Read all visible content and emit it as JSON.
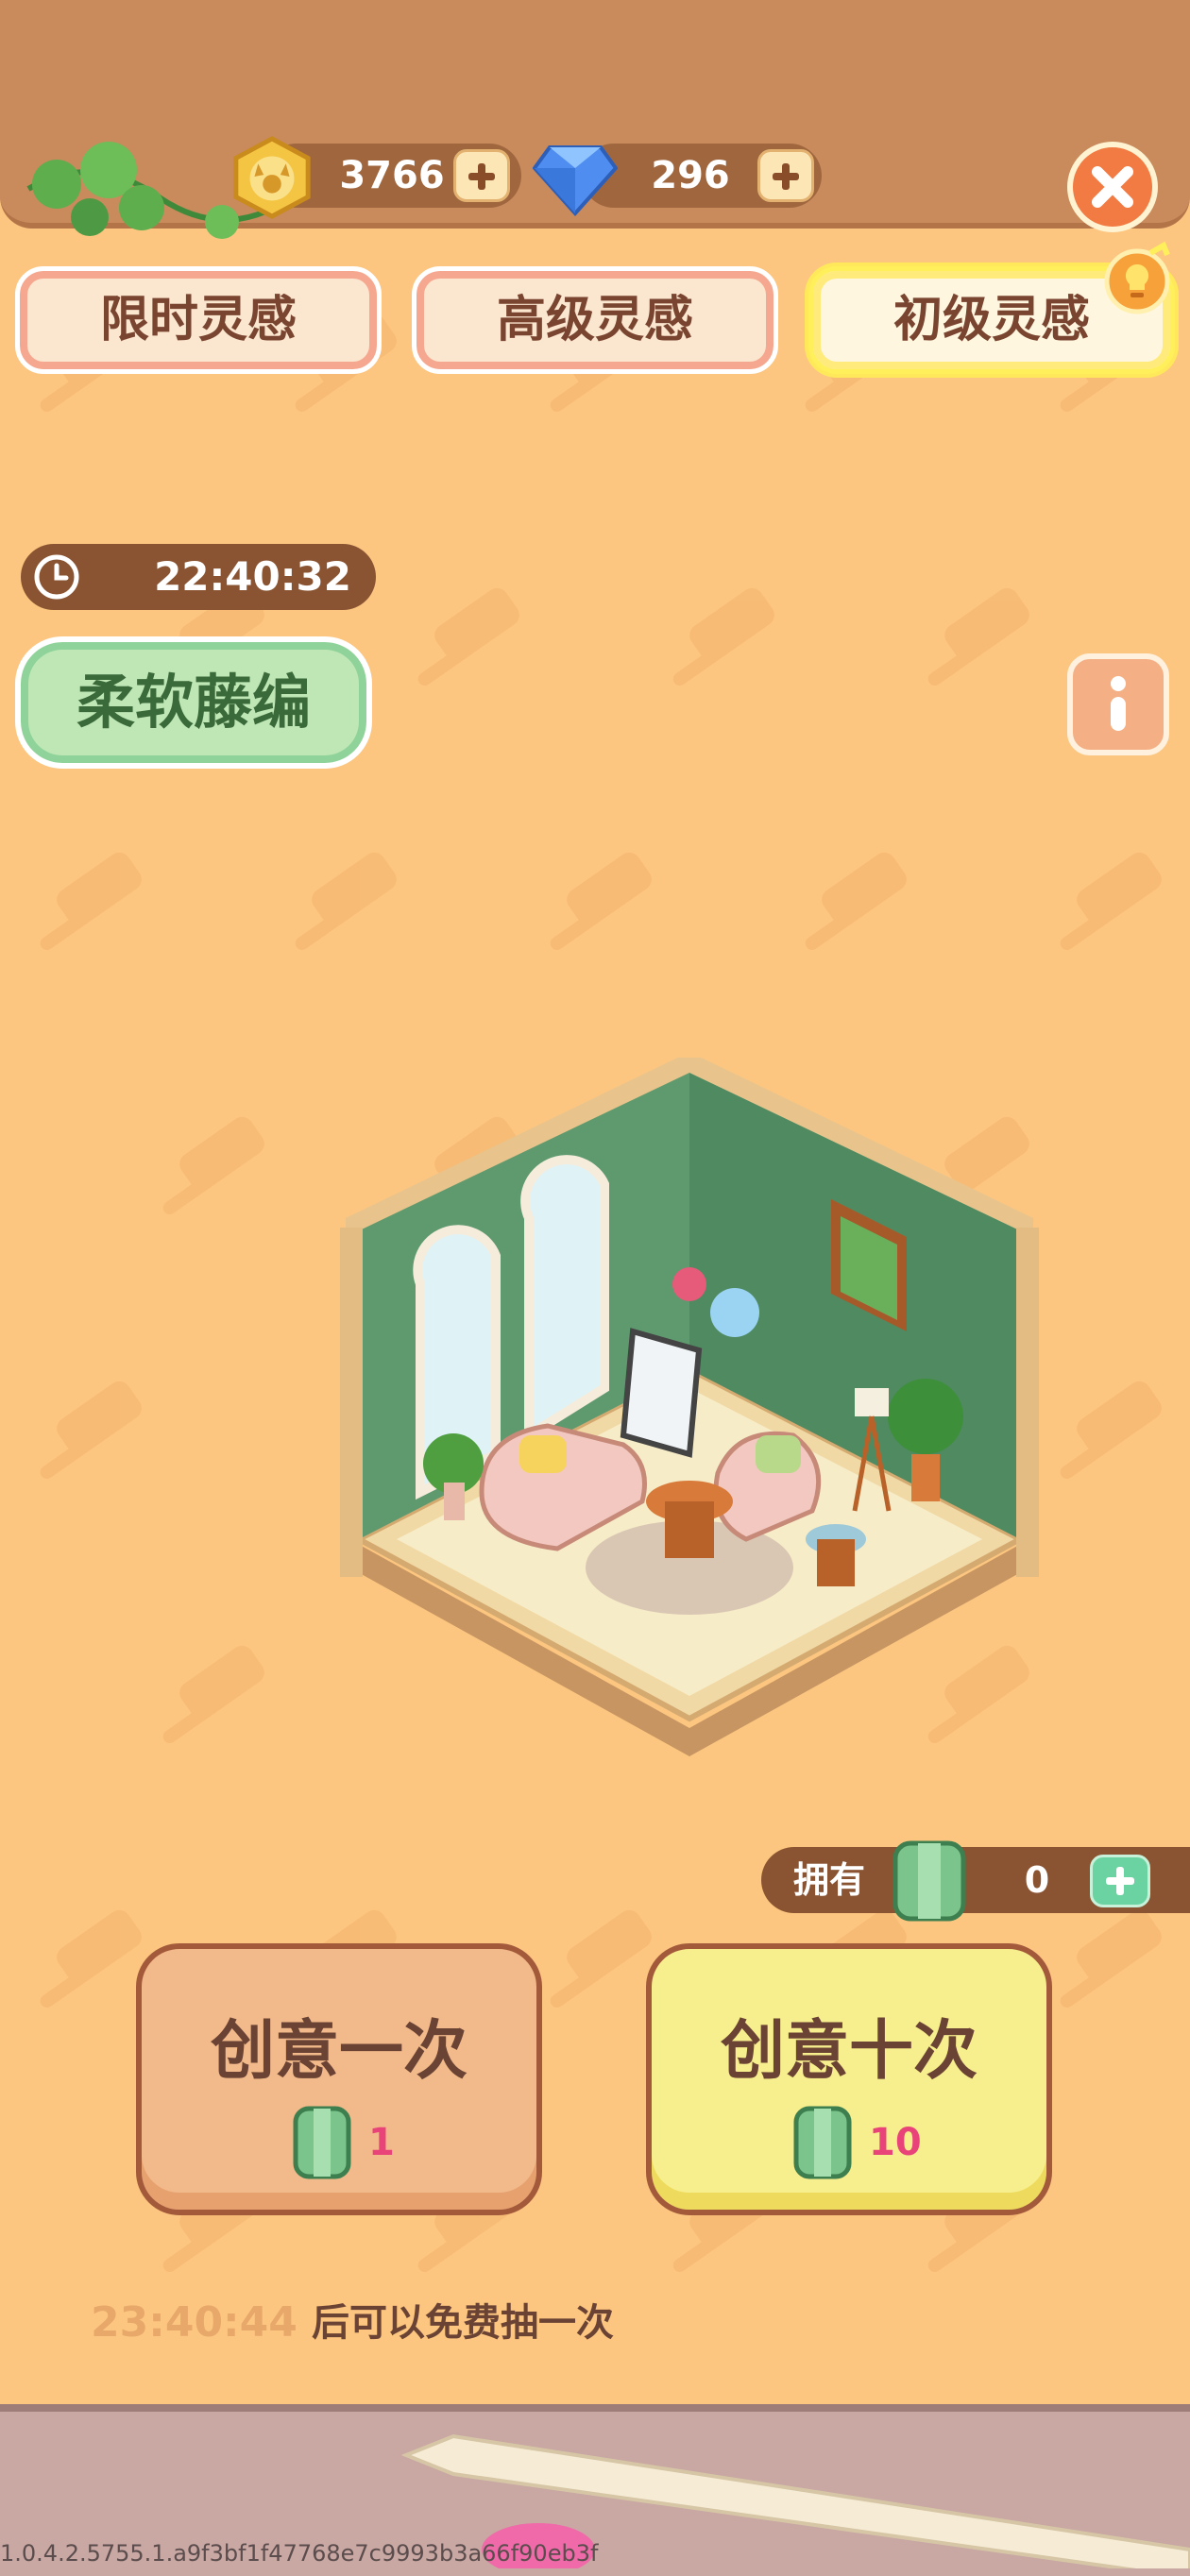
{
  "header": {
    "coins": "3766",
    "gems": "296"
  },
  "tabs": [
    {
      "label": "限时灵感",
      "active": false
    },
    {
      "label": "高级灵感",
      "active": false
    },
    {
      "label": "初级灵感",
      "active": true
    }
  ],
  "timer": {
    "value": "22:40:32"
  },
  "theme": {
    "label": "柔软藤编"
  },
  "owned": {
    "label": "拥有",
    "value": "0"
  },
  "actions": {
    "once": {
      "title": "创意一次",
      "cost": "1"
    },
    "ten": {
      "title": "创意十次",
      "cost": "10"
    }
  },
  "free_draw": {
    "time": "23:40:44",
    "text": "后可以免费抽一次"
  },
  "version": "1.0.4.2.5755.1.a9f3bf1f47768e7c9993b3a66f90eb3f",
  "colors": {
    "background": "#fcc680",
    "header": "#c98a5c",
    "accent_orange": "#f27a43",
    "price_pink": "#e9447a"
  }
}
